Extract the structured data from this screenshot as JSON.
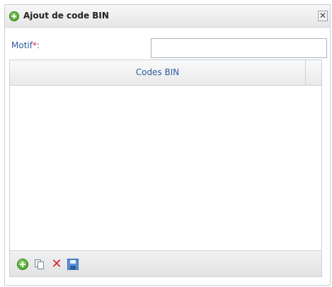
{
  "dialog": {
    "title": "Ajout de code BIN",
    "close_label": "✕"
  },
  "form": {
    "motif_label": "Motif",
    "required_marker": "*",
    "colon": ":",
    "motif_value": ""
  },
  "grid": {
    "columns": [
      "Codes BIN"
    ],
    "rows": []
  },
  "toolbar": {
    "icons": [
      "add-icon",
      "copy-icon",
      "delete-icon",
      "save-icon"
    ]
  },
  "colors": {
    "label_blue": "#2c5aa0",
    "required_red": "#e0252b",
    "add_green": "#3e9b23",
    "delete_red": "#d8242a",
    "save_blue": "#5b8fd1"
  }
}
